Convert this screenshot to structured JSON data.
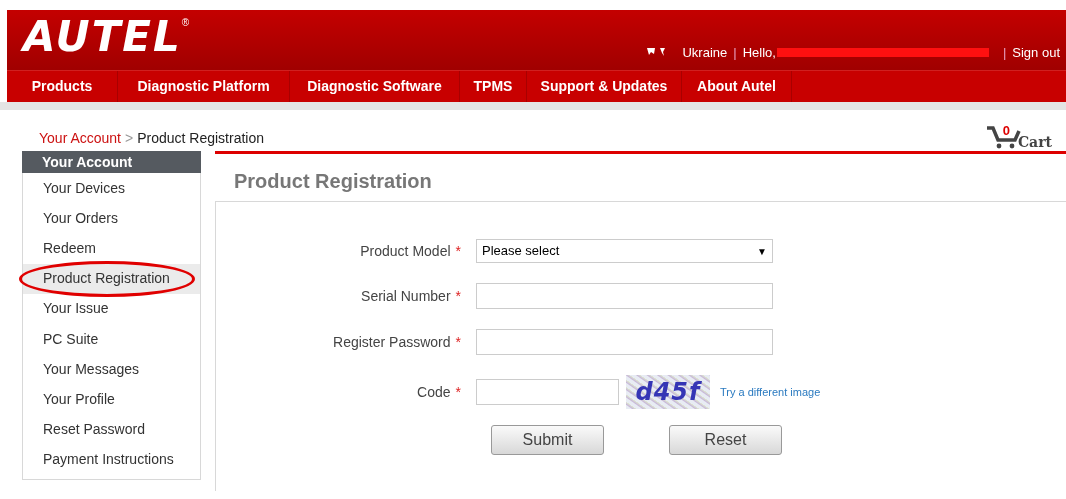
{
  "header": {
    "logo": "AUTEL",
    "registered": "®",
    "country": "Ukraine",
    "separators": [
      "|",
      "|"
    ],
    "greeting": "Hello,",
    "sign_out": "Sign out"
  },
  "nav": [
    "Products",
    "Diagnostic Platform",
    "Diagnostic Software",
    "TPMS",
    "Support & Updates",
    "About Autel"
  ],
  "breadcrumb": {
    "link": "Your Account",
    "separator": ">",
    "current": "Product Registration"
  },
  "cart": {
    "count": "0",
    "label": "Cart"
  },
  "sidebar": {
    "title": "Your Account",
    "items": [
      {
        "label": "Your Devices",
        "selected": false
      },
      {
        "label": "Your Orders",
        "selected": false
      },
      {
        "label": "Redeem",
        "selected": false
      },
      {
        "label": "Product Registration",
        "selected": true
      },
      {
        "label": "Your Issue",
        "selected": false
      },
      {
        "label": "PC Suite",
        "selected": false
      },
      {
        "label": "Your Messages",
        "selected": false
      },
      {
        "label": "Your Profile",
        "selected": false
      },
      {
        "label": "Reset Password",
        "selected": false
      },
      {
        "label": "Payment Instructions",
        "selected": false
      }
    ]
  },
  "page_title": "Product Registration",
  "form": {
    "fields": [
      {
        "kind": "select",
        "label": "Product Model",
        "required": "*",
        "value": "Please select",
        "arrow": "▼"
      },
      {
        "kind": "text",
        "label": "Serial Number",
        "required": "*"
      },
      {
        "kind": "password",
        "label": "Register Password",
        "required": "*"
      },
      {
        "kind": "captcha",
        "label": "Code",
        "required": "*",
        "captcha": "d45f",
        "link": "Try a different image"
      }
    ],
    "buttons": [
      "Submit",
      "Reset"
    ]
  }
}
